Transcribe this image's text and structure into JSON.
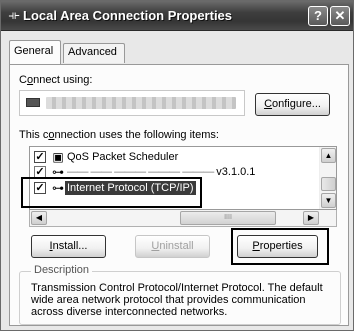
{
  "window": {
    "title": "Local Area Connection Properties",
    "title_icon": "network-connection-icon",
    "help_label": "?",
    "close_label": "✕"
  },
  "tabs": [
    {
      "label": "General",
      "active": true
    },
    {
      "label": "Advanced",
      "active": false
    }
  ],
  "connect": {
    "label_prefix": "C",
    "label_underlined": "o",
    "label_suffix": "nnect using:",
    "adapter_name": "",
    "configure_prefix": "",
    "configure_underlined": "C",
    "configure_suffix": "onfigure..."
  },
  "items_section": {
    "label_prefix": "This c",
    "label_underlined": "o",
    "label_suffix": "nnection uses the following items:"
  },
  "items": [
    {
      "label": "QoS Packet Scheduler",
      "checked": true,
      "icon": "scheduler-icon"
    },
    {
      "label": "v3.1.0.1",
      "checked": true,
      "icon": "protocol-icon"
    },
    {
      "label": "Internet Protocol (TCP/IP)",
      "checked": true,
      "icon": "protocol-icon",
      "selected": true
    }
  ],
  "buttons": {
    "install_underlined": "I",
    "install_suffix": "nstall...",
    "uninstall_underlined": "U",
    "uninstall_suffix": "ninstall",
    "properties_underlined": "P",
    "properties_suffix": "roperties"
  },
  "description": {
    "legend": "Description",
    "text": "Transmission Control Protocol/Internet Protocol. The default wide area network protocol that provides communication across diverse interconnected networks."
  },
  "scroll": {
    "up_arrow": "▲",
    "down_arrow": "▼",
    "left_arrow": "◀",
    "right_arrow": "▶",
    "grip": "IIII"
  }
}
